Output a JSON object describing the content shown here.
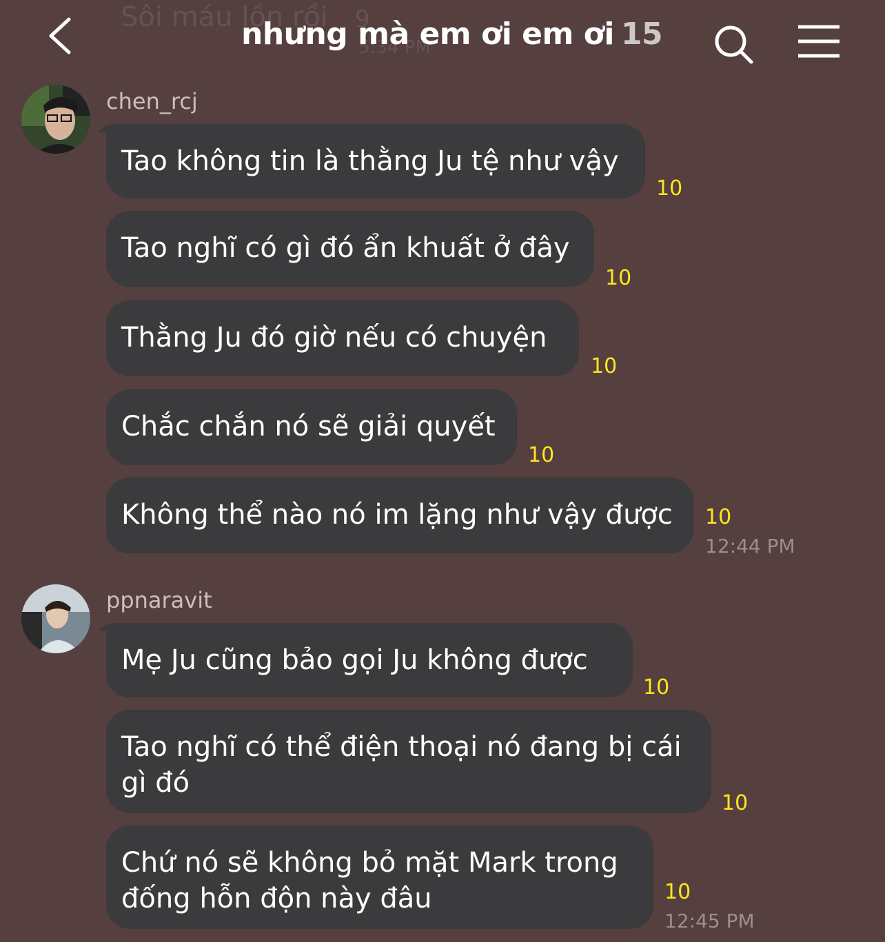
{
  "header": {
    "ghost_title": "Sôi máu lồn rồi",
    "ghost_count": "9",
    "ghost_time": "5:34 PM",
    "title": "nhưng mà em ơi em ơi",
    "member_count": "15",
    "back_icon": "chevron-left-icon",
    "search_icon": "search-icon",
    "menu_icon": "menu-icon"
  },
  "groups": [
    {
      "username": "chen_rcj",
      "messages": [
        {
          "text": "Tao không tin là thằng Ju tệ như vậy",
          "count": "10"
        },
        {
          "text": "Tao nghĩ có gì đó ẩn khuất ở đây",
          "count": "10"
        },
        {
          "text": "Thằng Ju đó giờ nếu có chuyện",
          "count": "10"
        },
        {
          "text": "Chắc chắn nó sẽ giải quyết",
          "count": "10"
        },
        {
          "text": "Không thể nào nó im lặng như vậy được",
          "count": "10",
          "time": "12:44 PM"
        }
      ]
    },
    {
      "username": "ppnaravit",
      "messages": [
        {
          "text": "Mẹ Ju cũng bảo gọi Ju không được",
          "count": "10"
        },
        {
          "text": "Tao nghĩ có thể điện thoại nó đang bị cái\ngì đó",
          "count": "10"
        },
        {
          "text": "Chứ nó sẽ không bỏ mặt Mark trong\nđống hỗn độn này đâu",
          "count": "10",
          "time": "12:45 PM"
        }
      ]
    }
  ],
  "colors": {
    "background": "#553f3f",
    "bubble": "#3b3a3c",
    "read_count": "#ffe61e"
  }
}
